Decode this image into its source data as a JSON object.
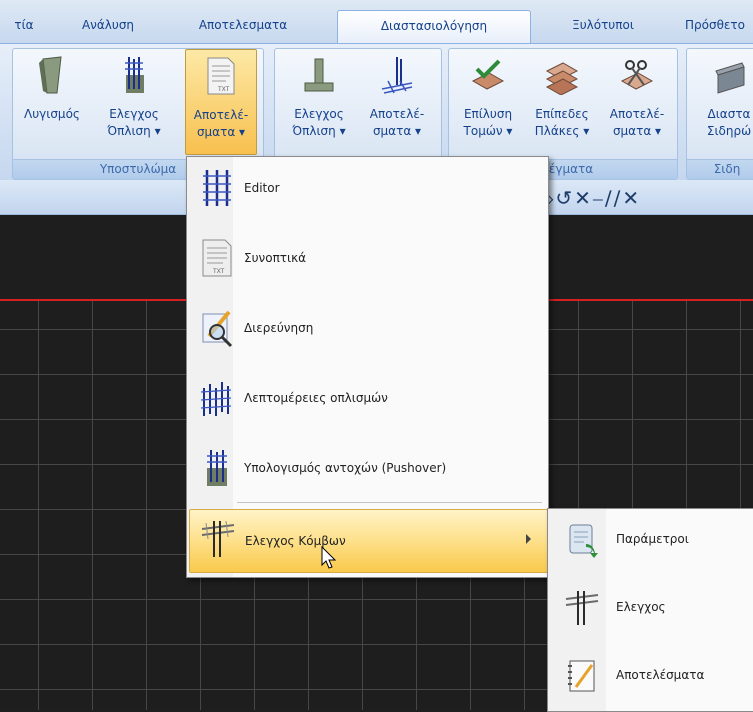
{
  "tabs": [
    "τία",
    "Ανάλυση",
    "Αποτελεσματα",
    "Διαστασιολόγηση",
    "Ξυλότυποι",
    "Πρόσθετο"
  ],
  "ribbon": {
    "groups": [
      {
        "label": "Υποστυλώμα",
        "buttons": [
          {
            "line1": "Λυγισμός",
            "line2": ""
          },
          {
            "line1": "Ελεγχος",
            "line2": "Όπλιση ▾"
          },
          {
            "line1": "Αποτελέ-",
            "line2": "σματα ▾"
          }
        ]
      },
      {
        "label": "",
        "buttons": [
          {
            "line1": "Ελεγχος",
            "line2": "Όπλιση ▾"
          },
          {
            "line1": "Αποτελέ-",
            "line2": "σματα ▾"
          }
        ]
      },
      {
        "label": "Πλέγματα",
        "buttons": [
          {
            "line1": "Επίλυση",
            "line2": "Τομών ▾"
          },
          {
            "line1": "Επίπεδες",
            "line2": "Πλάκες ▾"
          },
          {
            "line1": "Αποτελέ-",
            "line2": "σματα ▾"
          }
        ]
      },
      {
        "label": "Σιδη",
        "buttons": [
          {
            "line1": "Διαστα",
            "line2": "Σιδηρώ"
          }
        ]
      }
    ]
  },
  "menu": {
    "items": [
      {
        "label": "Editor",
        "icon": "rebar-cage-icon"
      },
      {
        "label": "Συνοπτικά",
        "icon": "txt-document-icon"
      },
      {
        "label": "Διερεύνηση",
        "icon": "magnifier-pencil-icon"
      },
      {
        "label": "Λεπτομέρειες οπλισμών",
        "icon": "rebar-details-icon"
      },
      {
        "label": "Υπολογισμός αντοχών (Pushover)",
        "icon": "column-rebar-icon"
      },
      {
        "label": "Ελεγχος Κόμβων",
        "icon": "joint-rebar-icon"
      }
    ]
  },
  "submenu": {
    "items": [
      {
        "label": "Παράμετροι",
        "icon": "parameters-scroll-icon"
      },
      {
        "label": "Ελεγχος",
        "icon": "joint-rebar-icon"
      },
      {
        "label": "Αποτελέσματα",
        "icon": "results-notepad-icon"
      }
    ]
  },
  "colors": {
    "ribbon_text": "#15428b",
    "highlight": "#f9c94a",
    "canvas": "#1e1e1e",
    "red_line": "#d42020"
  }
}
